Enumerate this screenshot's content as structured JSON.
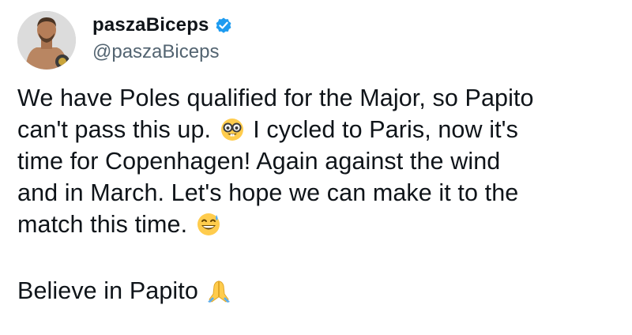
{
  "author": {
    "display_name": "paszaBiceps",
    "handle": "@paszaBiceps",
    "verified_color": "#1d9bf0"
  },
  "tweet": {
    "line1": "We have Poles qualified for the Major, so Papito",
    "line2a": "can't pass this up.",
    "line2b": "I cycled to Paris, now it's",
    "line3": "time for Copenhagen! Again against the wind",
    "line4": "and in March. Let's hope we can make it to the",
    "line5": "match this time.",
    "line6": "Believe in Papito"
  },
  "emojis": [
    "nerd-face-icon",
    "grinning-sweat-icon",
    "folded-hands-icon"
  ],
  "colors": {
    "text": "#0f1419",
    "secondary_text": "#536471",
    "accent": "#1d9bf0"
  }
}
